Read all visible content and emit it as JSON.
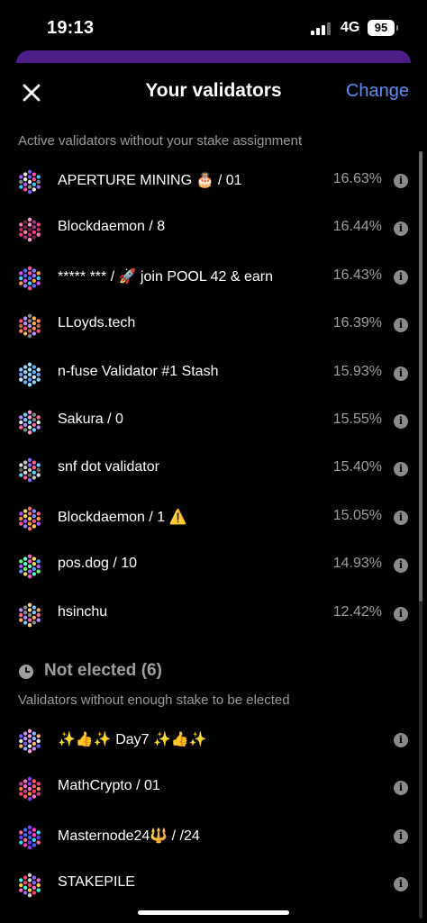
{
  "status_bar": {
    "time": "19:13",
    "network": "4G",
    "battery": "95"
  },
  "header": {
    "title": "Your validators",
    "change_label": "Change"
  },
  "active": {
    "description": "Active validators without your stake assignment",
    "validators": [
      {
        "name": "APERTURE MINING 🎂 / 01",
        "percent": "16.63%"
      },
      {
        "name": "Blockdaemon / 8",
        "percent": "16.44%"
      },
      {
        "name": "***** *** / 🚀 join POOL 42 & earn",
        "percent": "16.43%"
      },
      {
        "name": "LLoyds.tech",
        "percent": "16.39%"
      },
      {
        "name": "n-fuse Validator #1 Stash",
        "percent": "15.93%"
      },
      {
        "name": "Sakura / 0",
        "percent": "15.55%"
      },
      {
        "name": "snf dot validator",
        "percent": "15.40%"
      },
      {
        "name": "Blockdaemon / 1 ⚠️",
        "percent": "15.05%"
      },
      {
        "name": "pos.dog / 10",
        "percent": "14.93%"
      },
      {
        "name": "hsinchu",
        "percent": "12.42%"
      }
    ]
  },
  "not_elected": {
    "title": "Not elected (6)",
    "description": "Validators without enough stake to be elected",
    "validators": [
      {
        "name": "✨👍✨ Day7 ✨👍✨"
      },
      {
        "name": "MathCrypto / 01"
      },
      {
        "name": "Masternode24🔱 / /24"
      },
      {
        "name": "STAKEPILE"
      }
    ]
  },
  "icons": {
    "info": "i",
    "close": "close-icon",
    "clock": "clock-icon",
    "avatar": "identicon"
  },
  "colors": {
    "accent": "#5b8def",
    "banner": "#4b1f87",
    "background": "#000000",
    "secondary_text": "#9e9e9e"
  }
}
